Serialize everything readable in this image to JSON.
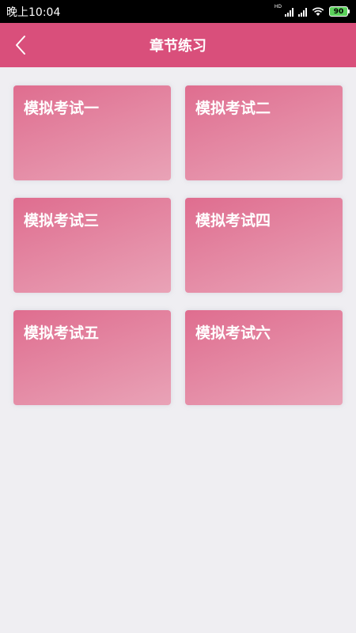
{
  "status_bar": {
    "time": "晚上10:04",
    "hd_label": "HD",
    "battery": "90"
  },
  "header": {
    "title": "章节练习",
    "back_icon": "chevron-left-icon"
  },
  "exams": [
    {
      "label": "模拟考试一"
    },
    {
      "label": "模拟考试二"
    },
    {
      "label": "模拟考试三"
    },
    {
      "label": "模拟考试四"
    },
    {
      "label": "模拟考试五"
    },
    {
      "label": "模拟考试六"
    }
  ],
  "colors": {
    "header_bg": "#d94f7b",
    "card_gradient_start": "#df6d8f",
    "card_gradient_end": "#e9a3b7",
    "page_bg": "#efeef2"
  }
}
